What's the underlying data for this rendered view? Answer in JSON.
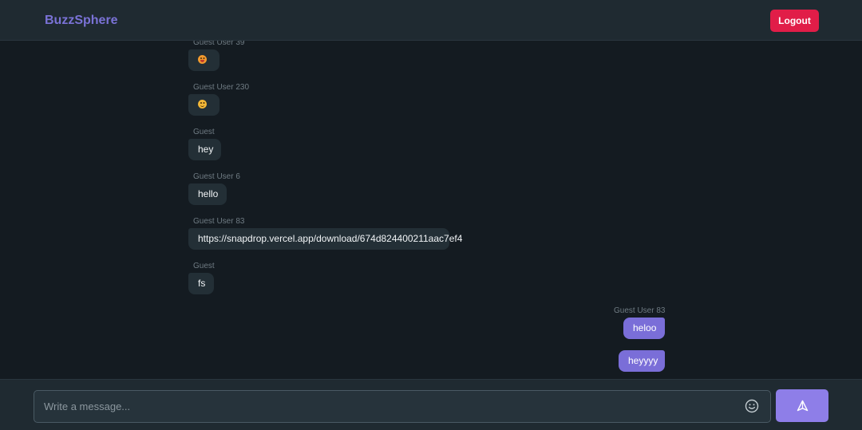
{
  "header": {
    "brand": "BuzzSphere",
    "logout_label": "Logout"
  },
  "messages": [
    {
      "direction": "in",
      "sender": "Guest User 39",
      "text": "",
      "emoji": "grinning-face-red-mouth"
    },
    {
      "direction": "in",
      "sender": "Guest User 230",
      "text": "",
      "emoji": "smiling-face"
    },
    {
      "direction": "in",
      "sender": "Guest",
      "text": "hey"
    },
    {
      "direction": "in",
      "sender": "Guest User 6",
      "text": "hello"
    },
    {
      "direction": "in",
      "sender": "Guest User 83",
      "text": "https://snapdrop.vercel.app/download/674d824400211aac7ef4"
    },
    {
      "direction": "in",
      "sender": "Guest",
      "text": "fs"
    },
    {
      "direction": "out",
      "sender": "Guest User 83",
      "text": "heloo"
    },
    {
      "direction": "out",
      "sender": "",
      "text": "heyyyy"
    }
  ],
  "composer": {
    "placeholder": "Write a message...",
    "value": "",
    "emoji_icon": "smiley-icon",
    "send_icon": "send-icon"
  },
  "colors": {
    "brand": "#7a72d6",
    "logout": "#e11d48",
    "outgoing_bubble": "#7a6ed8",
    "incoming_bubble": "#232f36",
    "send_button": "#8e7ee8"
  }
}
